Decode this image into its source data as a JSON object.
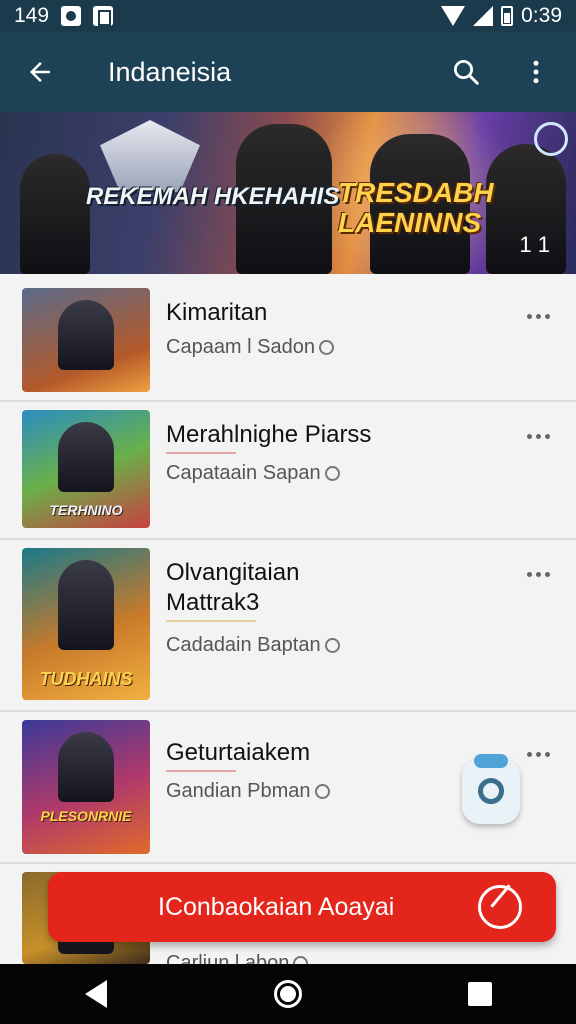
{
  "status": {
    "left_number": "149",
    "time": "0:39"
  },
  "app_bar": {
    "title": "Indaneisia",
    "icons": [
      "arrow-back-icon",
      "search-icon",
      "more-vertical-icon"
    ]
  },
  "banner": {
    "left_text": "REKEMAH HKEHAHIS",
    "right_text": "TRESDABH LAENINNS",
    "badge": "1 1"
  },
  "list_items": [
    {
      "title": "Kimaritan",
      "subtitle": "Capaam l Sadon"
    },
    {
      "title": "Merahlnighe Piarss",
      "subtitle": "Capataain Sapan",
      "thumb_text": "TERHNINO"
    },
    {
      "title": "Olvangitaian",
      "title2": "Mattrak3",
      "subtitle": "Cadadain Baptan",
      "thumb_text": "TUDHAINS"
    },
    {
      "title": "Geturtaiakem",
      "subtitle": "Gandian Pbman",
      "thumb_text": "PLESONRNIE"
    },
    {
      "title": "",
      "subtitle": "Carliun l abon"
    }
  ],
  "cta": {
    "label": "IConbaokaian Aoayai",
    "icon": "compass-icon"
  },
  "colors": {
    "status_bar": "#1b3a4b",
    "app_bar": "#1e4255",
    "cta": "#e3251b"
  }
}
